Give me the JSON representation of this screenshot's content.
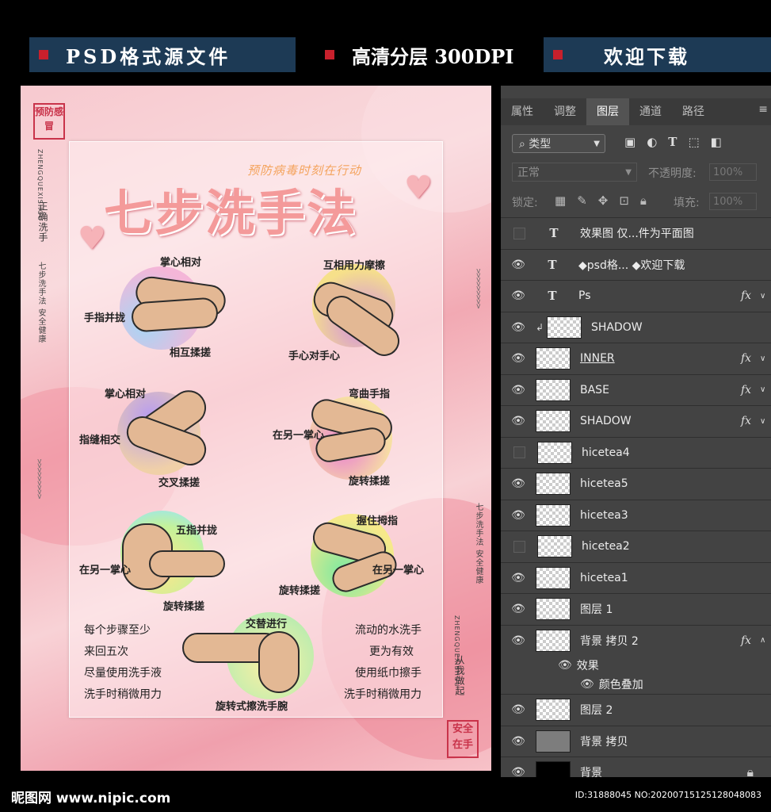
{
  "banners": {
    "b1": "PSD格式源文件",
    "b2": "高清分层 300DPI",
    "b3": "欢迎下载"
  },
  "poster": {
    "stamp_top": "预防感冒",
    "stamp_bottom": "安全在手",
    "v_left_cn": "正确洗手",
    "v_left_en": "ZHENGQUEXISHOU",
    "v_left_small": "七步洗手法 安全健康",
    "v_right_small": "七步洗手法 安全健康",
    "v_right_cn": "从我做起",
    "v_right_en": "ZHENGQUEXISHOU",
    "title": "七步洗手法",
    "subtitle": "预防病毒时刻在行动",
    "labels": {
      "s1a": "掌心相对",
      "s1b": "手指并拢",
      "s1c": "相互揉搓",
      "s2a": "互相用力摩擦",
      "s2b": "手心对手心",
      "s3a": "掌心相对",
      "s3b": "指缝相交",
      "s3c": "交叉揉搓",
      "s4a": "弯曲手指",
      "s4b": "在另一掌心",
      "s4c": "旋转揉搓",
      "s5a": "五指并拢",
      "s5b": "在另一掌心",
      "s5c": "旋转揉搓",
      "s6a": "握住拇指",
      "s6b": "在另一掌心",
      "s6c": "旋转揉搓",
      "s7a": "交替进行",
      "s7b": "旋转式擦洗手腕"
    },
    "notes_left": [
      "每个步骤至少",
      "来回五次",
      "尽量使用洗手液",
      "洗手时稍微用力"
    ],
    "notes_right": [
      "流动的水洗手",
      "更为有效",
      "使用纸巾擦手",
      "洗手时稍微用力"
    ]
  },
  "panel": {
    "tabs": [
      "属性",
      "调整",
      "图层",
      "通道",
      "路径"
    ],
    "active_tab": "图层",
    "filter": "类型",
    "blend": "正常",
    "opacity_label": "不透明度:",
    "opacity_value": "100%",
    "lock_label": "锁定:",
    "fill_label": "填充:",
    "fill_value": "100%",
    "layers": [
      {
        "name": "效果图 仅...件为平面图",
        "kind": "text",
        "visible": false,
        "fx": false
      },
      {
        "name": "◆psd格... ◆欢迎下载",
        "kind": "text",
        "visible": true,
        "fx": false
      },
      {
        "name": "Ps",
        "kind": "text",
        "visible": true,
        "fx": true
      },
      {
        "name": "SHADOW",
        "kind": "clip",
        "visible": true,
        "fx": false
      },
      {
        "name": "INNER",
        "kind": "smart",
        "visible": true,
        "fx": true
      },
      {
        "name": "BASE",
        "kind": "smart",
        "visible": true,
        "fx": true
      },
      {
        "name": "SHADOW",
        "kind": "pixel",
        "visible": true,
        "fx": true
      },
      {
        "name": "hicetea4",
        "kind": "pixel",
        "visible": false,
        "fx": false
      },
      {
        "name": "hicetea5",
        "kind": "pixel",
        "visible": true,
        "fx": false
      },
      {
        "name": "hicetea3",
        "kind": "pixel",
        "visible": true,
        "fx": false
      },
      {
        "name": "hicetea2",
        "kind": "pixel",
        "visible": false,
        "fx": false
      },
      {
        "name": "hicetea1",
        "kind": "pixel",
        "visible": true,
        "fx": false
      },
      {
        "name": "图层 1",
        "kind": "pixel",
        "visible": true,
        "fx": false
      },
      {
        "name": "背景 拷贝 2",
        "kind": "pixel",
        "visible": true,
        "fx": true
      }
    ],
    "effects_label": "效果",
    "effect_item": "颜色叠加",
    "layers_bottom": [
      {
        "name": "图层 2",
        "kind": "pixel"
      },
      {
        "name": "背景 拷贝",
        "kind": "gray"
      },
      {
        "name": "背景",
        "kind": "black"
      }
    ]
  },
  "footer": {
    "logo": "昵图网 www.nipic.com",
    "id": "ID:31888045 NO:20200715125128048083"
  }
}
